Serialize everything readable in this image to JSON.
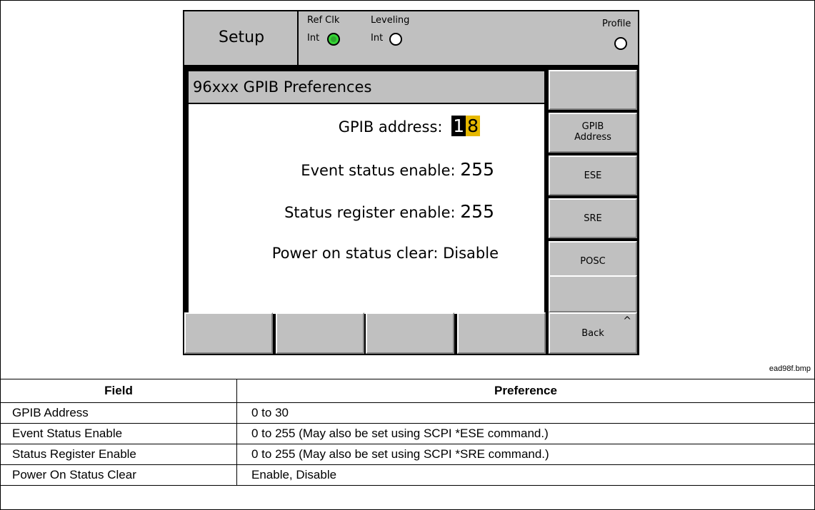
{
  "status_bar": {
    "mode": "Setup",
    "ref_clk_label": "Ref Clk",
    "ref_clk_value": "Int",
    "leveling_label": "Leveling",
    "leveling_value": "Int",
    "profile_label": "Profile"
  },
  "panel": {
    "title": "96xxx GPIB Preferences",
    "rows": [
      {
        "label": "GPIB address:",
        "value_d1": "1",
        "value_d2": "8"
      },
      {
        "label": "Event status enable:",
        "value": "255"
      },
      {
        "label": "Status register enable:",
        "value": "255"
      },
      {
        "label": "Power on status clear:",
        "value": "Disable"
      }
    ]
  },
  "softkeys": {
    "side": [
      "",
      "GPIB Address",
      "ESE",
      "SRE",
      "POSC",
      ""
    ],
    "gpib_line1": "GPIB",
    "gpib_line2": "Address",
    "bottom": [
      "",
      "",
      "",
      "",
      "Back"
    ],
    "back_indicator": "^"
  },
  "caption": "ead98f.bmp",
  "table": {
    "headers": [
      "Field",
      "Preference"
    ],
    "rows": [
      [
        "GPIB Address",
        "0 to 30"
      ],
      [
        "Event Status Enable",
        "0 to 255 (May also be set using SCPI *ESE command.)"
      ],
      [
        "Status Register Enable",
        "0 to 255 (May also be set using SCPI *SRE command.)"
      ],
      [
        "Power On Status Clear",
        "Enable, Disable"
      ]
    ]
  },
  "colors": {
    "panel_gray": "#c0c0c0",
    "led_active": "#2ea82e",
    "cursor_highlight": "#e6b800"
  }
}
